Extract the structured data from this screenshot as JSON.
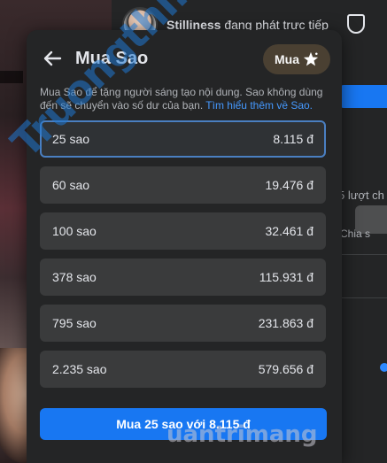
{
  "background": {
    "streamer_name": "Stilliness",
    "status_text": "đang phát trực tiếp",
    "views_text": "5 lượt ch",
    "share_text": "Chia s"
  },
  "dialog": {
    "title": "Mua Sao",
    "buy_pill_label": "Mua",
    "description": "Mua Sao để tặng người sáng tạo nội dung. Sao không dùng đến sẽ chuyển vào số dư của bạn.",
    "learn_more": "Tìm hiểu thêm về Sao.",
    "options": [
      {
        "qty": "25 sao",
        "price": "8.115 đ",
        "selected": true
      },
      {
        "qty": "60 sao",
        "price": "19.476 đ",
        "selected": false
      },
      {
        "qty": "100 sao",
        "price": "32.461 đ",
        "selected": false
      },
      {
        "qty": "378 sao",
        "price": "115.931 đ",
        "selected": false
      },
      {
        "qty": "795 sao",
        "price": "231.863 đ",
        "selected": false
      },
      {
        "qty": "2.235 sao",
        "price": "579.656 đ",
        "selected": false
      }
    ],
    "buy_button": "Mua 25 sao với 8.115 đ"
  },
  "watermarks": {
    "left": "Truongthi.com",
    "bottom": "uantrimang"
  },
  "colors": {
    "accent": "#1877f2",
    "link": "#4599ff",
    "pill_bg": "#4a4032"
  }
}
